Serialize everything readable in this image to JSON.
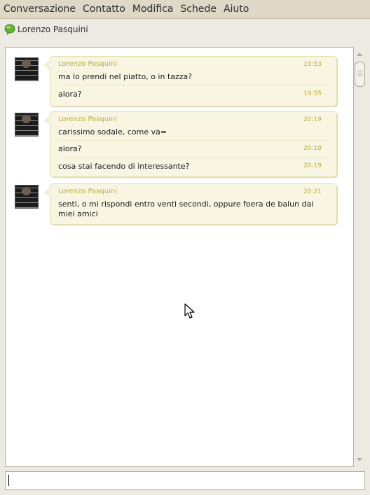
{
  "menu": [
    "Conversazione",
    "Contatto",
    "Modifica",
    "Schede",
    "Aiuto"
  ],
  "contact": {
    "name": "Lorenzo Pasquini"
  },
  "groups": [
    {
      "sender": "Lorenzo Pasquini",
      "messages": [
        {
          "text": "ma lo prendi nel piatto, o in tazza?",
          "time": "19:53"
        },
        {
          "text": "alora?",
          "time": "19:55"
        }
      ]
    },
    {
      "sender": "Lorenzo Pasquini",
      "messages": [
        {
          "text": "carissimo sodale, come va=",
          "time": "20:19"
        },
        {
          "text": "alora?",
          "time": "20:19"
        },
        {
          "text": "cosa stai facendo di interessante?",
          "time": "20:19"
        }
      ]
    },
    {
      "sender": "Lorenzo Pasquini",
      "messages": [
        {
          "text": "senti, o mi rispondi entro venti secondi, oppure foera de balun dai miei amici",
          "time": "20:21"
        }
      ]
    }
  ],
  "input": {
    "value": ""
  },
  "colors": {
    "accent": "#b8ad42",
    "bubble": "#f8f6e3",
    "menubar": "#e0d8c6"
  }
}
